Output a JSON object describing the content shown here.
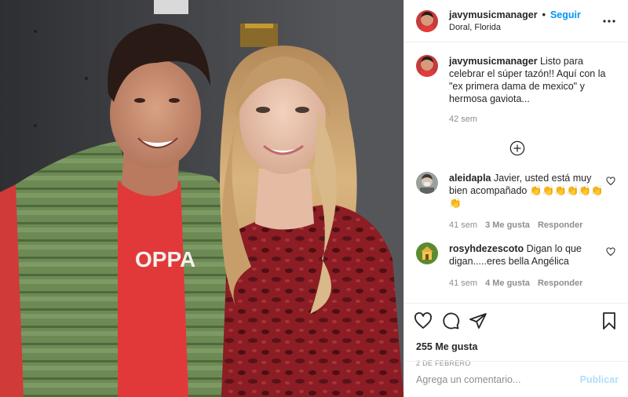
{
  "post": {
    "author": "javymusicmanager",
    "follow_label": "Seguir",
    "separator": "•",
    "location": "Doral, Florida",
    "more_icon": "more-horizontal-icon"
  },
  "caption": {
    "author": "javymusicmanager",
    "text": "Listo para celebrar el súper tazón!! Aquí con la \"ex primera dama de mexico\" y hermosa gaviota...",
    "time": "42 sem"
  },
  "load_more_icon": "plus-circle-icon",
  "comments": [
    {
      "author": "aleidapla",
      "text": "Javier, usted está muy bien acompañado",
      "emoji": "👏👏👏👏👏👏👏",
      "time": "41 sem",
      "likes": "3 Me gusta",
      "reply": "Responder"
    },
    {
      "author": "rosyhdezescoto",
      "text": "Digan lo que digan.....eres bella Angélica",
      "time": "41 sem",
      "likes": "4 Me gusta",
      "reply": "Responder"
    }
  ],
  "actions": {
    "icons": [
      "heart-icon",
      "comment-icon",
      "share-icon",
      "bookmark-icon"
    ],
    "likes": "255 Me gusta",
    "date": "2 DE FEBRERO"
  },
  "add_comment": {
    "placeholder": "Agrega un comentario...",
    "publish_label": "Publicar"
  },
  "colors": {
    "accent": "#0095f6",
    "publish_disabled": "#b2dffc",
    "muted": "#8e8e8e",
    "text": "#262626"
  }
}
